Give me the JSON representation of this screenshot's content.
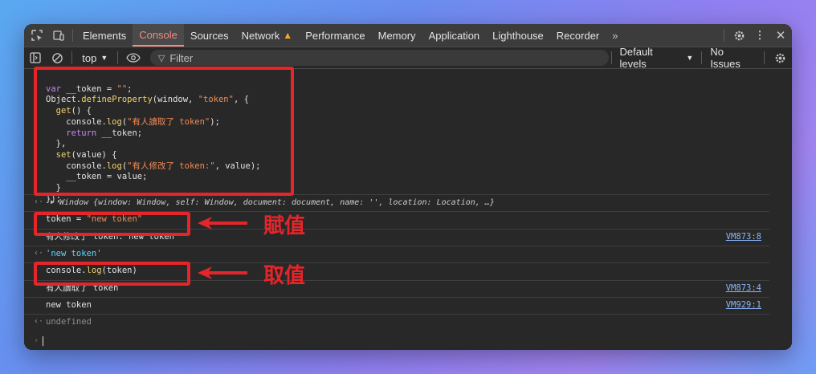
{
  "tabs": [
    "Elements",
    "Console",
    "Sources",
    "Network",
    "Performance",
    "Memory",
    "Application",
    "Lighthouse",
    "Recorder"
  ],
  "toolbar": {
    "context": "top",
    "filter_placeholder": "Filter",
    "levels": "Default levels",
    "issues": "No Issues"
  },
  "code_lines": [
    "var __token = \"\";",
    "Object.defineProperty(window, \"token\", {",
    "  get() {",
    "    console.log(\"有人讀取了 token\");",
    "    return __token;",
    "  },",
    "  set(value) {",
    "    console.log(\"有人修改了 token:\", value);",
    "    __token = value;",
    "  }",
    "});"
  ],
  "window_result": "Window {window: Window, self: Window, document: document, name: '', location: Location, …}",
  "rows": {
    "assign": "token = \"new token\"",
    "log_set": "有人修改了 token: new token",
    "log_set_src": "VM873:8",
    "assign_result": "'new token'",
    "read": "console.log(token)",
    "log_get": "有人讀取了 token",
    "log_get_src": "VM873:4",
    "log_value": "new token",
    "log_value_src": "VM929:1",
    "read_result": "undefined"
  },
  "annotations": {
    "assign_label": "賦值",
    "read_label": "取值",
    "color": "#e5252a"
  }
}
